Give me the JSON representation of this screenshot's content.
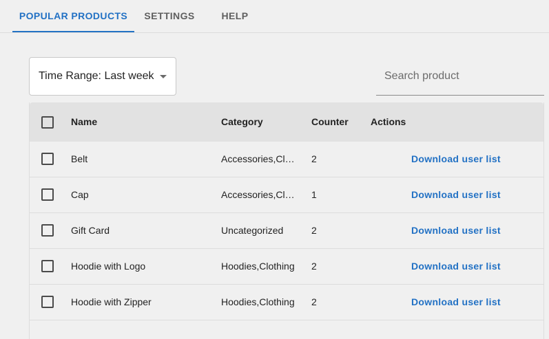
{
  "tabs": [
    {
      "label": "POPULAR PRODUCTS",
      "active": true
    },
    {
      "label": "SETTINGS",
      "active": false
    },
    {
      "label": "HELP",
      "active": false
    }
  ],
  "filters": {
    "time_range_label": "Time Range: Last week",
    "search_placeholder": "Search product",
    "search_value": ""
  },
  "table": {
    "columns": {
      "name": "Name",
      "category": "Category",
      "counter": "Counter",
      "actions": "Actions"
    },
    "rows": [
      {
        "name": "Belt",
        "category": "Accessories,Clothing",
        "counter": "2",
        "action": "Download user list"
      },
      {
        "name": "Cap",
        "category": "Accessories,Clothing",
        "counter": "1",
        "action": "Download user list"
      },
      {
        "name": "Gift Card",
        "category": "Uncategorized",
        "counter": "2",
        "action": "Download user list"
      },
      {
        "name": "Hoodie with Logo",
        "category": "Hoodies,Clothing",
        "counter": "2",
        "action": "Download user list"
      },
      {
        "name": "Hoodie with Zipper",
        "category": "Hoodies,Clothing",
        "counter": "2",
        "action": "Download user list"
      }
    ]
  },
  "colors": {
    "accent": "#2271c4",
    "background": "#f0f0f0",
    "header_bg": "#e2e2e2"
  }
}
